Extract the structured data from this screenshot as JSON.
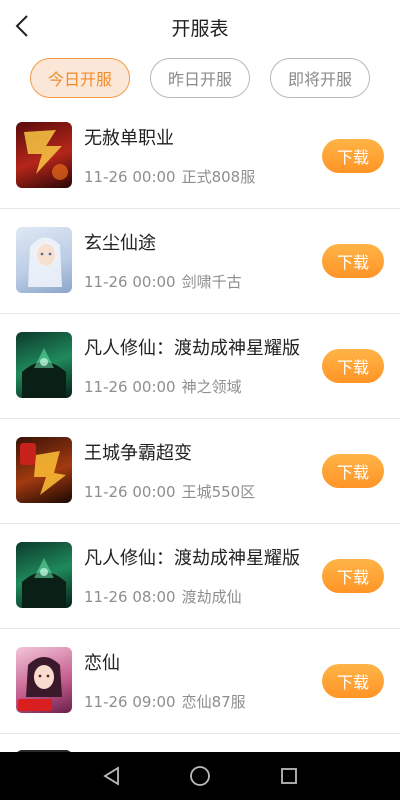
{
  "header": {
    "title": "开服表",
    "back_icon": "back-arrow-icon"
  },
  "tabs": [
    {
      "label": "今日开服",
      "active": true
    },
    {
      "label": "昨日开服",
      "active": false
    },
    {
      "label": "即将开服",
      "active": false
    }
  ],
  "games": [
    {
      "name": "无赦单职业",
      "time": "11-26 00:00",
      "server": "正式808服",
      "button": "下载",
      "icon": "game-icon-wushe"
    },
    {
      "name": "玄尘仙途",
      "time": "11-26 00:00",
      "server": "剑啸千古",
      "button": "下载",
      "icon": "game-icon-xuanchen"
    },
    {
      "name": "凡人修仙：渡劫成神星耀版",
      "time": "11-26 00:00",
      "server": "神之领域",
      "button": "下载",
      "icon": "game-icon-fanren"
    },
    {
      "name": "王城争霸超变",
      "time": "11-26 00:00",
      "server": "王城550区",
      "button": "下载",
      "icon": "game-icon-wangcheng"
    },
    {
      "name": "凡人修仙：渡劫成神星耀版",
      "time": "11-26 08:00",
      "server": "渡劫成仙",
      "button": "下载",
      "icon": "game-icon-fanren"
    },
    {
      "name": "恋仙",
      "time": "11-26 09:00",
      "server": "恋仙87服",
      "button": "下载",
      "icon": "game-icon-lianxian"
    }
  ],
  "colors": {
    "accent": "#f08c2c",
    "button_top": "#ffb447",
    "button_bottom": "#ff9426",
    "active_tab_bg": "#fbe7d8"
  },
  "navbar": {
    "icons": [
      "nav-back-icon",
      "nav-home-icon",
      "nav-recents-icon"
    ]
  }
}
